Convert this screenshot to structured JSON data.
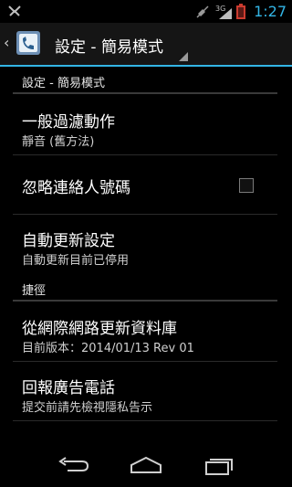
{
  "status_bar": {
    "time": "1:27",
    "signal_label": "3G",
    "left_icon": "usb-debug-icon",
    "mute_icon": "mute-icon",
    "battery_icon": "battery-icon",
    "accent_color": "#33b5e5"
  },
  "action_bar": {
    "title": "設定 - 簡易模式",
    "app_icon": "app-icon",
    "back_icon": "chevron-left-icon"
  },
  "settings": {
    "category1": "設定 - 簡易模式",
    "pref1": {
      "title": "一般過濾動作",
      "summary": "靜音 (舊方法)"
    },
    "pref2": {
      "title": "忽略連絡人號碼",
      "checked": false
    },
    "pref3": {
      "title": "自動更新設定",
      "summary": "自動更新目前已停用"
    },
    "category2": "捷徑",
    "pref4": {
      "title": "從網際網路更新資料庫",
      "summary": "目前版本：2014/01/13 Rev 01"
    },
    "pref5": {
      "title": "回報廣告電話",
      "summary": "提交前請先檢視隱私告示"
    }
  },
  "nav_bar": {
    "back_icon": "back-icon",
    "home_icon": "home-icon",
    "recents_icon": "recents-icon"
  }
}
